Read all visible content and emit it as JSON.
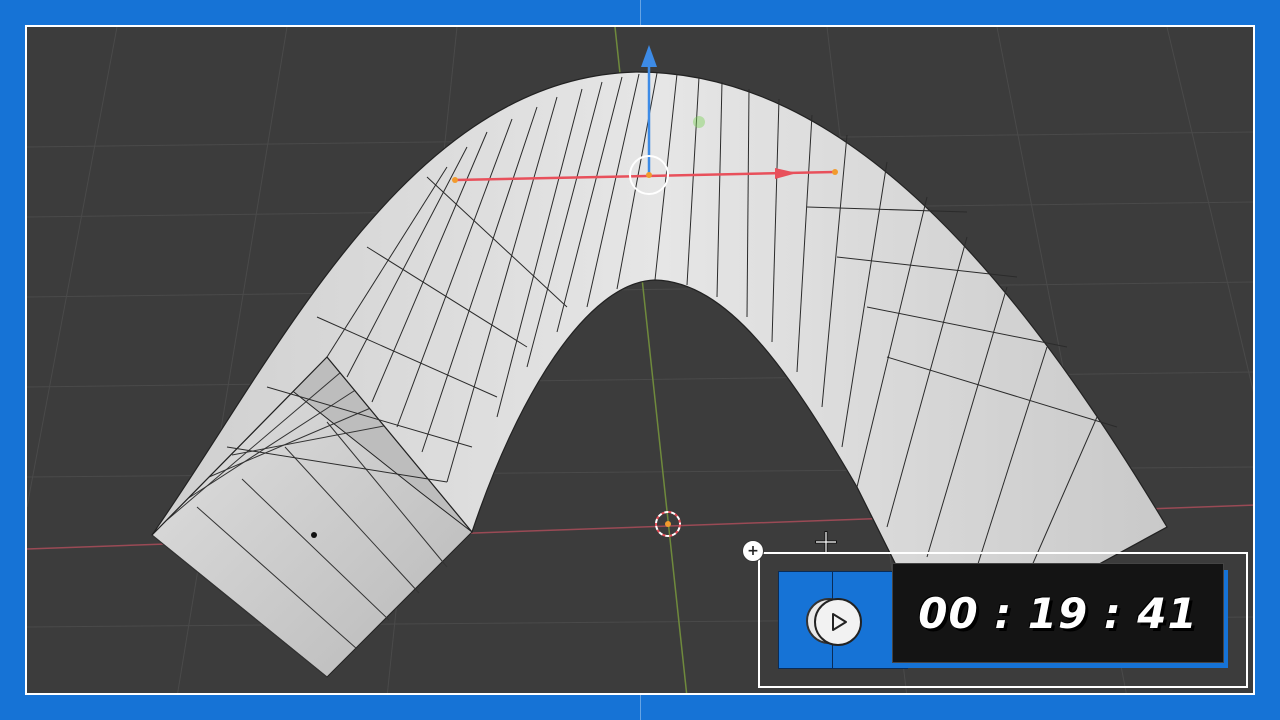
{
  "timer": {
    "elapsed": "00 : 19 : 41"
  },
  "panel": {
    "add_symbol": "+"
  },
  "colors": {
    "frame": "#1673d6",
    "viewport_bg": "#3c3c3c",
    "mesh_face": "#d9d9d9",
    "gizmo_x": "#e8505b",
    "gizmo_z": "#3d8be6"
  },
  "icons": [
    "play-icon",
    "cursor-crosshair-icon",
    "add-icon",
    "3d-cursor-icon",
    "transform-gizmo-icon"
  ]
}
